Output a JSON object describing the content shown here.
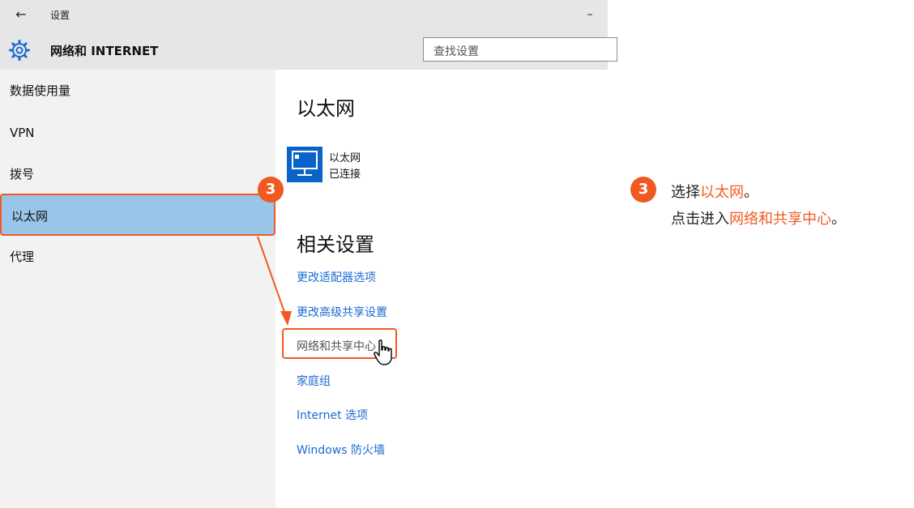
{
  "window": {
    "back_glyph": "←",
    "title": "设置",
    "minimize_glyph": "–"
  },
  "header": {
    "section_title": "网络和 INTERNET",
    "search_placeholder": "查找设置"
  },
  "sidebar": {
    "items": [
      {
        "label": "数据使用量"
      },
      {
        "label": "VPN"
      },
      {
        "label": "拨号"
      },
      {
        "label": "以太网",
        "selected": true
      },
      {
        "label": "代理"
      }
    ]
  },
  "content": {
    "heading": "以太网",
    "adapter": {
      "name": "以太网",
      "status": "已连接"
    },
    "related_heading": "相关设置",
    "links": [
      {
        "label": "更改适配器选项"
      },
      {
        "label": "更改高级共享设置"
      },
      {
        "label": "网络和共享中心",
        "highlighted": true
      },
      {
        "label": "家庭组"
      },
      {
        "label": "Internet 选项"
      },
      {
        "label": "Windows 防火墙"
      }
    ]
  },
  "annotation": {
    "step_number": "3",
    "line1_prefix": "选择",
    "line1_highlight": "以太网",
    "line1_suffix": "。",
    "line2_prefix": "点击进入",
    "line2_highlight": "网络和共享中心",
    "line2_suffix": "。"
  },
  "colors": {
    "accent": "#f05a22",
    "link": "#1a6bd3",
    "selected_bg": "#99c5e8",
    "icon_blue": "#0a63c9"
  }
}
